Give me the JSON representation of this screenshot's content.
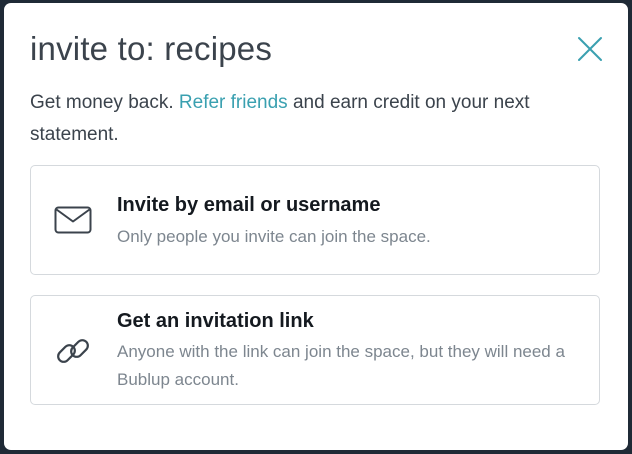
{
  "modal": {
    "title": "invite to: recipes",
    "subtitle_prefix": "Get money back. ",
    "subtitle_link": "Refer friends",
    "subtitle_suffix": " and earn credit on your next statement."
  },
  "options": [
    {
      "icon": "envelope-icon",
      "title": "Invite by email or username",
      "description": "Only people you invite can join the space."
    },
    {
      "icon": "link-icon",
      "title": "Get an invitation link",
      "description": "Anyone with the link can join the space, but they will need a Bublup account."
    }
  ],
  "colors": {
    "accent": "#3aa0b0",
    "text": "#3b434c",
    "muted": "#7d868f",
    "border": "#d5d9dd"
  }
}
